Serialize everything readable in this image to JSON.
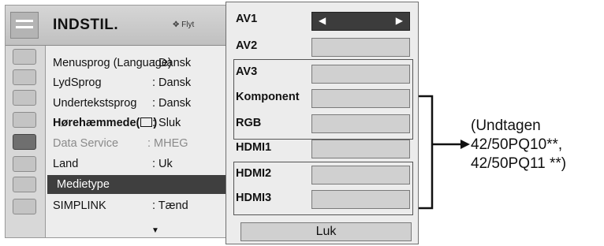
{
  "menu": {
    "title": "INDSTIL.",
    "move_hint": "Flyt",
    "items": [
      {
        "label": "Menusprog (Language)",
        "value": ": Dansk"
      },
      {
        "label": "LydSprog",
        "value": ": Dansk"
      },
      {
        "label": "Undertekstsprog",
        "value": ": Dansk"
      },
      {
        "label": "Hørehæmmede(",
        "suffix": ")",
        "value": ": Sluk"
      },
      {
        "label": "Data Service",
        "value": ": MHEG"
      },
      {
        "label": "Land",
        "value": ": Uk"
      },
      {
        "label": "Medietype",
        "value": ""
      },
      {
        "label": "SIMPLINK",
        "value": ": Tænd"
      }
    ],
    "sidebar_icons": [
      "picture-icon",
      "screen-icon",
      "audio-icon",
      "clock-icon",
      "option-icon",
      "lock-icon",
      "input-icon",
      "usb-icon"
    ]
  },
  "popup": {
    "inputs": [
      "AV1",
      "AV2",
      "AV3",
      "Komponent",
      "RGB",
      "HDMI1",
      "HDMI2",
      "HDMI3"
    ],
    "selected_index": 0,
    "close_label": "Luk"
  },
  "note": {
    "line1": "(Undtagen",
    "line2": "42/50PQ10**,",
    "line3": "42/50PQ11 **)"
  },
  "colors": {
    "highlight": "#3f3f3f",
    "panel": "#ececec",
    "field": "#d0d0d0"
  }
}
